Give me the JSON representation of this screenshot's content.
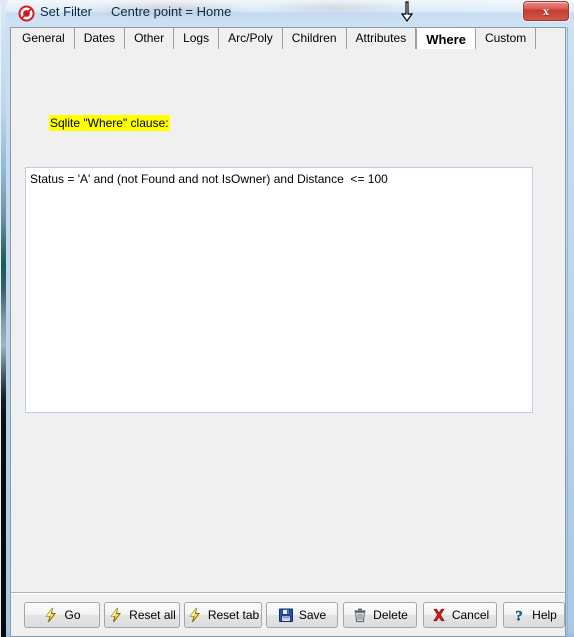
{
  "window": {
    "app_icon": "red-circle-slash-icon",
    "title": "Set Filter",
    "subtitle": "Centre point = Home",
    "close_label": "x",
    "cursor": "down-arrow-cursor"
  },
  "tabs": [
    {
      "label": "General",
      "selected": false
    },
    {
      "label": "Dates",
      "selected": false
    },
    {
      "label": "Other",
      "selected": false
    },
    {
      "label": "Logs",
      "selected": false
    },
    {
      "label": "Arc/Poly",
      "selected": false
    },
    {
      "label": "Children",
      "selected": false
    },
    {
      "label": "Attributes",
      "selected": false
    },
    {
      "label": "Where",
      "selected": true
    },
    {
      "label": "Custom",
      "selected": false
    }
  ],
  "panel": {
    "where_label": "Sqlite \"Where\" clause:",
    "where_label_highlight": "#ffff00",
    "where_clause": "Status = 'A' and (not Found and not IsOwner) and Distance  <= 100",
    "textarea_placeholder": ""
  },
  "buttons": [
    {
      "label": "Go",
      "icon": "lightning-bolt-icon"
    },
    {
      "label": "Reset all",
      "icon": "lightning-bolt-icon"
    },
    {
      "label": "Reset tab",
      "icon": "lightning-bolt-icon"
    },
    {
      "label": "Save",
      "icon": "floppy-disk-icon"
    },
    {
      "label": "Delete",
      "icon": "trash-can-icon"
    },
    {
      "label": "Cancel",
      "icon": "red-x-icon"
    },
    {
      "label": "Help",
      "icon": "question-mark-icon"
    }
  ],
  "colors": {
    "title_bar": "#cfe0f2",
    "panel_bg": "#f0f0f0",
    "highlight": "#ffff00",
    "textarea_border": "#b8d1e8",
    "close_button": "#c33c31"
  }
}
